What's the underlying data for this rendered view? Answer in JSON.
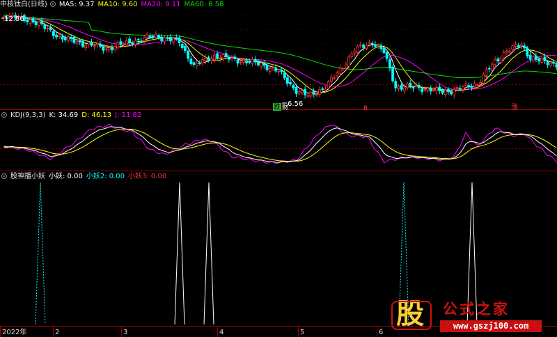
{
  "main_panel": {
    "stock_name": "中核钛白(日线)",
    "ma_labels": [
      {
        "text": "MA5: 9.37",
        "color": "#ffffff"
      },
      {
        "text": "MA10: 9.60",
        "color": "#ffff00"
      },
      {
        "text": "MA20: 9.11",
        "color": "#ff00ff"
      },
      {
        "text": "MA60: 8.58",
        "color": "#00e000"
      }
    ],
    "high_price_label": "12.86",
    "low_price_label": "6.56",
    "markers": [
      {
        "text": "跌",
        "color": "#000000",
        "bg": "#2eb82e"
      },
      {
        "text": "B",
        "color": "#ff3333",
        "bg": ""
      },
      {
        "text": "涨",
        "color": "#ff3333",
        "bg": ""
      }
    ],
    "colors": {
      "up": "#ff3232",
      "down": "#00ffff",
      "ma5": "#ffffff",
      "ma10": "#ffff00",
      "ma20": "#ff00ff",
      "ma60": "#00e000",
      "grid": "#7a0000"
    }
  },
  "kdj_panel": {
    "title": "KDJ(9,3,3)",
    "k_label": "K: 34.69",
    "d_label": "D: 46.13",
    "j_label": "J: 11.82",
    "colors": {
      "k": "#ffffff",
      "d": "#ffff00",
      "j": "#ff00ff"
    }
  },
  "yao_panel": {
    "title": "股神播小妖",
    "label1": "小妖: 0.00",
    "label2": "小妖2: 0.00",
    "label3": "小妖3: 0.00",
    "colors": {
      "label1": "#ffffff",
      "label2": "#00ffff",
      "label3": "#ff3333"
    }
  },
  "x_axis": {
    "labels": [
      "2022年",
      "2",
      "3",
      "4",
      "5",
      "6"
    ]
  },
  "watermark": {
    "logo": "股",
    "name": "公式之家",
    "url": "www.gszj100.com"
  }
}
